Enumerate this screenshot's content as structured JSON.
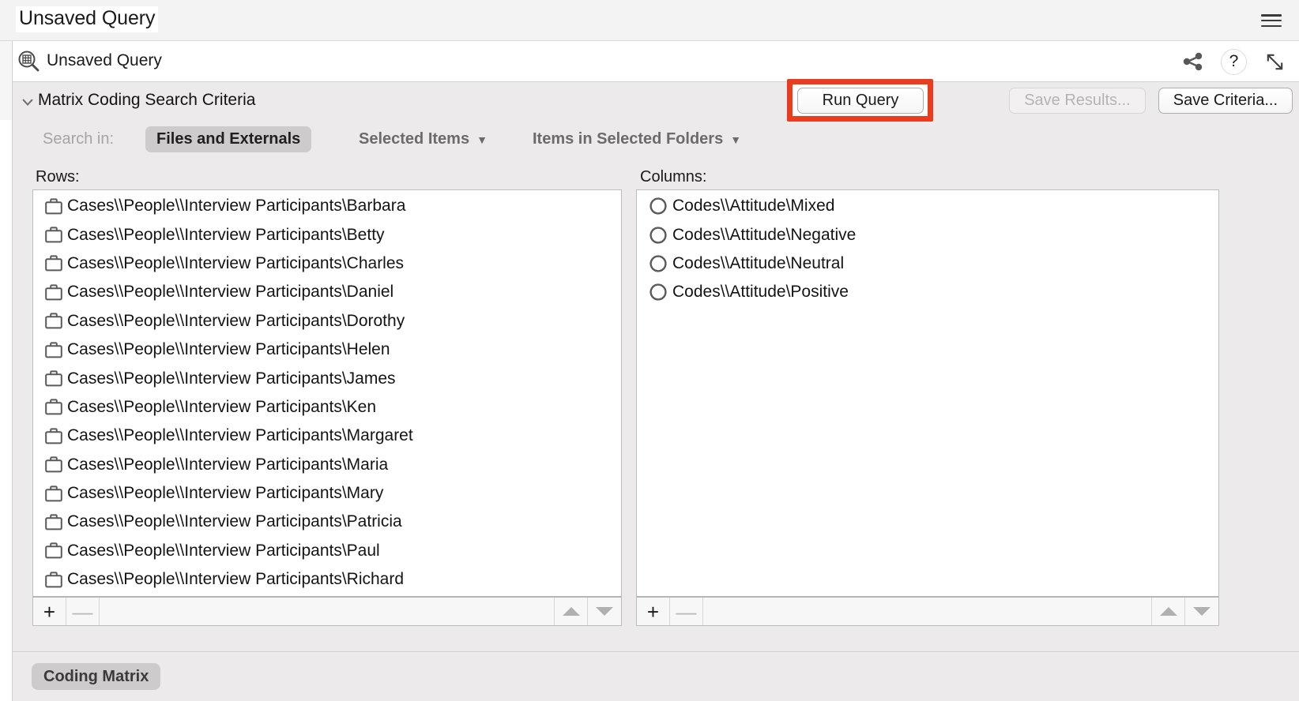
{
  "window": {
    "title": "Unsaved Query",
    "menu_icon": "hamburger-icon"
  },
  "document_header": {
    "icon": "matrix-query-icon",
    "title": "Unsaved Query",
    "actions": [
      {
        "name": "share-icon",
        "label": "Share"
      },
      {
        "name": "help-icon",
        "label": "?"
      },
      {
        "name": "expand-icon",
        "label": "Expand"
      }
    ]
  },
  "criteria": {
    "collapse_icon": "chevron-down-icon",
    "title": "Matrix Coding Search Criteria",
    "buttons": {
      "run_query": "Run Query",
      "save_results": "Save Results...",
      "save_criteria": "Save Criteria..."
    },
    "run_query_highlight_color": "#ea3d20",
    "save_results_disabled": true
  },
  "search_in": {
    "label": "Search in:",
    "options": [
      {
        "label": "Files and Externals",
        "selected": true,
        "dropdown": false
      },
      {
        "label": "Selected Items",
        "selected": false,
        "dropdown": true
      },
      {
        "label": "Items in Selected Folders",
        "selected": false,
        "dropdown": true
      }
    ]
  },
  "rows_panel": {
    "label": "Rows:",
    "items": [
      {
        "icon": "case-icon",
        "label": "Cases\\\\People\\\\Interview Participants\\Barbara"
      },
      {
        "icon": "case-icon",
        "label": "Cases\\\\People\\\\Interview Participants\\Betty"
      },
      {
        "icon": "case-icon",
        "label": "Cases\\\\People\\\\Interview Participants\\Charles"
      },
      {
        "icon": "case-icon",
        "label": "Cases\\\\People\\\\Interview Participants\\Daniel"
      },
      {
        "icon": "case-icon",
        "label": "Cases\\\\People\\\\Interview Participants\\Dorothy"
      },
      {
        "icon": "case-icon",
        "label": "Cases\\\\People\\\\Interview Participants\\Helen"
      },
      {
        "icon": "case-icon",
        "label": "Cases\\\\People\\\\Interview Participants\\James"
      },
      {
        "icon": "case-icon",
        "label": "Cases\\\\People\\\\Interview Participants\\Ken"
      },
      {
        "icon": "case-icon",
        "label": "Cases\\\\People\\\\Interview Participants\\Margaret"
      },
      {
        "icon": "case-icon",
        "label": "Cases\\\\People\\\\Interview Participants\\Maria"
      },
      {
        "icon": "case-icon",
        "label": "Cases\\\\People\\\\Interview Participants\\Mary"
      },
      {
        "icon": "case-icon",
        "label": "Cases\\\\People\\\\Interview Participants\\Patricia"
      },
      {
        "icon": "case-icon",
        "label": "Cases\\\\People\\\\Interview Participants\\Paul"
      },
      {
        "icon": "case-icon",
        "label": "Cases\\\\People\\\\Interview Participants\\Richard"
      }
    ],
    "footer": {
      "add": "+",
      "remove": "—",
      "move_up": "move-up",
      "move_down": "move-down",
      "remove_disabled": true
    }
  },
  "columns_panel": {
    "label": "Columns:",
    "items": [
      {
        "icon": "code-icon",
        "label": "Codes\\\\Attitude\\Mixed"
      },
      {
        "icon": "code-icon",
        "label": "Codes\\\\Attitude\\Negative"
      },
      {
        "icon": "code-icon",
        "label": "Codes\\\\Attitude\\Neutral"
      },
      {
        "icon": "code-icon",
        "label": "Codes\\\\Attitude\\Positive"
      }
    ],
    "footer": {
      "add": "+",
      "remove": "—",
      "move_up": "move-up",
      "move_down": "move-down",
      "remove_disabled": true
    }
  },
  "bottom_tabs": [
    {
      "label": "Coding Matrix",
      "selected": true
    }
  ]
}
